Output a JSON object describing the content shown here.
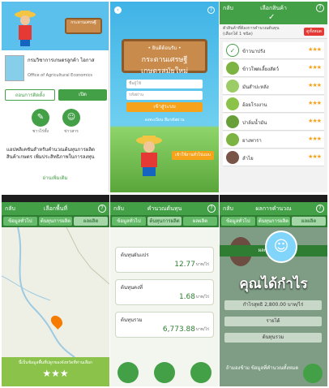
{
  "p1": {
    "app_name": "กรมวิชาการเกษตรลูกค้า ไอกาส",
    "app_sub": "Office of Agricultural Economics",
    "sign_text": "กระดานเศรษฐี",
    "uninstall": "ถอนการติดตั้ง",
    "open": "เปิด",
    "icon1_label": "ชาวไร่ทั้ง",
    "icon2_label": "ข่าวสาร",
    "description": "แอปพลิเคชันสำหรับคำนวณต้นทุนการผลิตสินค้าเกษตร เพิ่มประสิทธิภาพในการลงทุน",
    "more": "อ่านเพิ่มเติม"
  },
  "p2": {
    "back": "‹",
    "help": "?",
    "sign_top": "• ยินดีต้อนรับ •",
    "sign_line1": "กระดานเศรษฐี",
    "sign_line2": "เกษตรสมัยใหม่",
    "username_placeholder": "ชื่อผู้ใช้",
    "password_placeholder": "รหัสผ่าน",
    "login": "เข้าสู่ระบบ",
    "links": "ลงทะเบียน   ลืมรหัสผ่าน",
    "guest": "เข้าใช้งานทั่วไปแบบ"
  },
  "p3": {
    "back": "กลับ",
    "title": "เลือกสินค้า",
    "help": "?",
    "subtitle": "ตัวสินค้าที่ต้องการคำนวณต้นทุน (เลือกได้ 1 ชนิด)",
    "badge": "ดูทั้งหมด",
    "items": [
      {
        "name": "ข้าวนาปรัง",
        "stars": "★★★"
      },
      {
        "name": "ข้าวโพดเลี้ยงสัตว์",
        "stars": "★★★"
      },
      {
        "name": "มันสำปะหลัง",
        "stars": "★★★"
      },
      {
        "name": "อ้อยโรงงาน",
        "stars": "★★★"
      },
      {
        "name": "ปาล์มน้ำมัน",
        "stars": "★★★"
      },
      {
        "name": "ยางพารา",
        "stars": "★★★"
      },
      {
        "name": "ลำไย",
        "stars": "★★★"
      }
    ]
  },
  "p4": {
    "back": "กลับ",
    "title": "เลือกพื้นที่",
    "help": "?",
    "tabs": [
      "ข้อมูลทั่วไป",
      "ต้นทุนการผลิต",
      "ผลผลิต"
    ],
    "footer": "นี้เป็นข้อมูลพื้นที่ปลูกของจังหวัดที่ท่านเลือก",
    "stars": "★★★"
  },
  "p5": {
    "back": "กลับ",
    "title": "คำนวณต้นทุน",
    "help": "?",
    "tabs": [
      "ข้อมูลทั่วไป",
      "ต้นทุนการผลิต",
      "ผลผลิต"
    ],
    "cards": [
      {
        "label": "ต้นทุนผันแปร",
        "value": "12.77",
        "unit": "บาท/ไร่"
      },
      {
        "label": "ต้นทุนคงที่",
        "value": "1.68",
        "unit": "บาท/ไร่"
      },
      {
        "label": "ต้นทุนรวม",
        "value": "6,773.88",
        "unit": "บาท/ไร่"
      }
    ]
  },
  "p6": {
    "back": "กลับ",
    "title": "ผลการคำนวณ",
    "help": "?",
    "tabs": [
      "ข้อมูลทั่วไป",
      "ต้นทุนการผลิต",
      "ผลผลิต"
    ],
    "bar": "ผลการคำนวณ",
    "profit": "คุณได้กำไร",
    "row1": "กำไรสุทธิ 2,800.00 บาท/ไร่",
    "row2": "รายได้",
    "row3": "ต้นทุนรวม",
    "check": "ถ้ามองข้าม ข้อมูลที่คำนวณทั้งหมด"
  }
}
